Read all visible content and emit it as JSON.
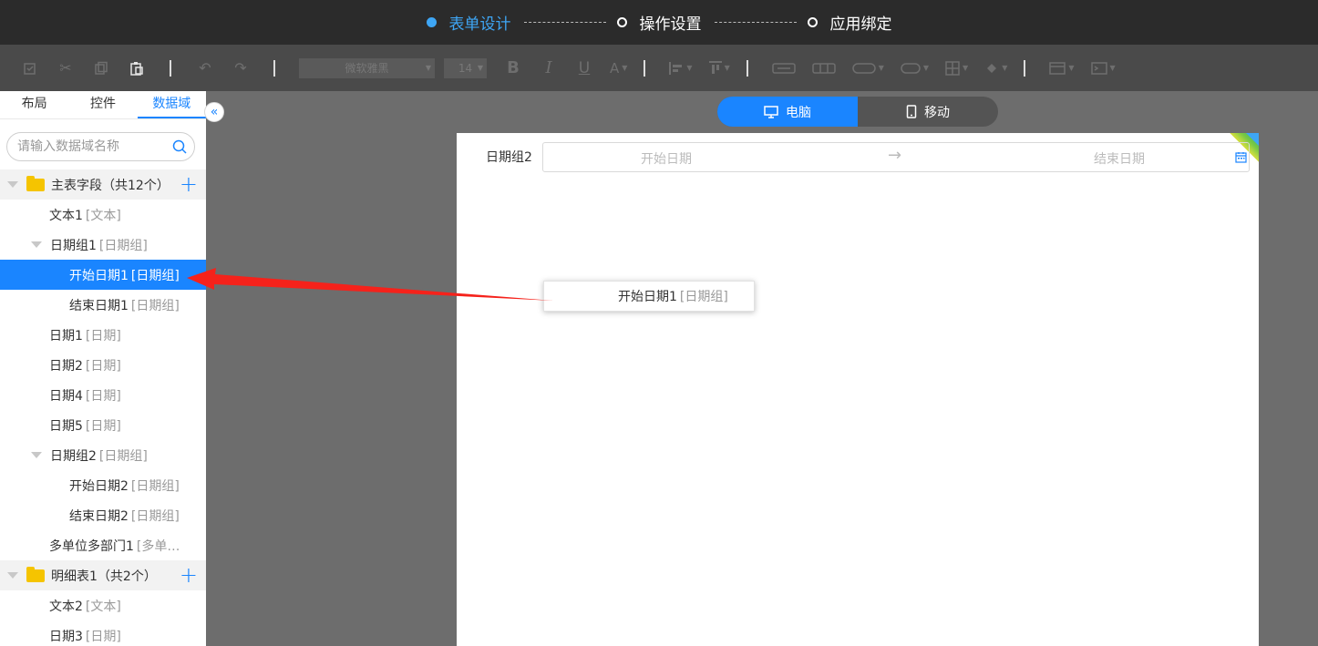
{
  "steps": [
    {
      "label": "表单设计",
      "active": true
    },
    {
      "label": "操作设置",
      "active": false
    },
    {
      "label": "应用绑定",
      "active": false
    }
  ],
  "toolbar": {
    "font_family": "微软雅黑",
    "font_size": "14",
    "icons": [
      "format-painter-icon",
      "cut-icon",
      "copy-icon",
      "paste-icon",
      "undo-icon",
      "redo-icon",
      "bold-icon",
      "italic-icon",
      "underline-icon",
      "font-color-icon",
      "align-left-icon",
      "align-top-icon",
      "merge-icon",
      "split-icon",
      "border-icon",
      "fill-color-icon",
      "insert-icon",
      "field-icon"
    ]
  },
  "left_panel": {
    "tabs": [
      "布局",
      "控件",
      "数据域"
    ],
    "active_tab": "数据域",
    "search_placeholder": "请输入数据域名称",
    "tree": [
      {
        "kind": "group",
        "label": "主表字段（共12个）"
      },
      {
        "kind": "item",
        "level": 1,
        "name": "文本1",
        "type": "[文本]"
      },
      {
        "kind": "item",
        "level": 1,
        "name": "日期组1",
        "type": "[日期组]",
        "expanded": true
      },
      {
        "kind": "item",
        "level": 2,
        "name": "开始日期1",
        "type": "[日期组]",
        "selected": true
      },
      {
        "kind": "item",
        "level": 2,
        "name": "结束日期1",
        "type": "[日期组]"
      },
      {
        "kind": "item",
        "level": 1,
        "name": "日期1",
        "type": "[日期]"
      },
      {
        "kind": "item",
        "level": 1,
        "name": "日期2",
        "type": "[日期]"
      },
      {
        "kind": "item",
        "level": 1,
        "name": "日期4",
        "type": "[日期]"
      },
      {
        "kind": "item",
        "level": 1,
        "name": "日期5",
        "type": "[日期]"
      },
      {
        "kind": "item",
        "level": 1,
        "name": "日期组2",
        "type": "[日期组]",
        "expanded": true
      },
      {
        "kind": "item",
        "level": 2,
        "name": "开始日期2",
        "type": "[日期组]"
      },
      {
        "kind": "item",
        "level": 2,
        "name": "结束日期2",
        "type": "[日期组]"
      },
      {
        "kind": "item",
        "level": 1,
        "name": "多单位多部门1",
        "type": "[多单…"
      },
      {
        "kind": "group",
        "label": "明细表1（共2个）"
      },
      {
        "kind": "item",
        "level": 1,
        "name": "文本2",
        "type": "[文本]"
      },
      {
        "kind": "item",
        "level": 1,
        "name": "日期3",
        "type": "[日期]"
      }
    ]
  },
  "device_switch": {
    "pc": "电脑",
    "mobile": "移动",
    "active": "电脑"
  },
  "canvas": {
    "field_label": "日期组2",
    "start_placeholder": "开始日期",
    "end_placeholder": "结束日期",
    "arrow": "→"
  },
  "drag_ghost": {
    "name": "开始日期1",
    "type": "[日期组]"
  },
  "colors": {
    "accent": "#1a85ff",
    "step_active": "#3ea6f5",
    "annotation_arrow": "#f5221b"
  }
}
